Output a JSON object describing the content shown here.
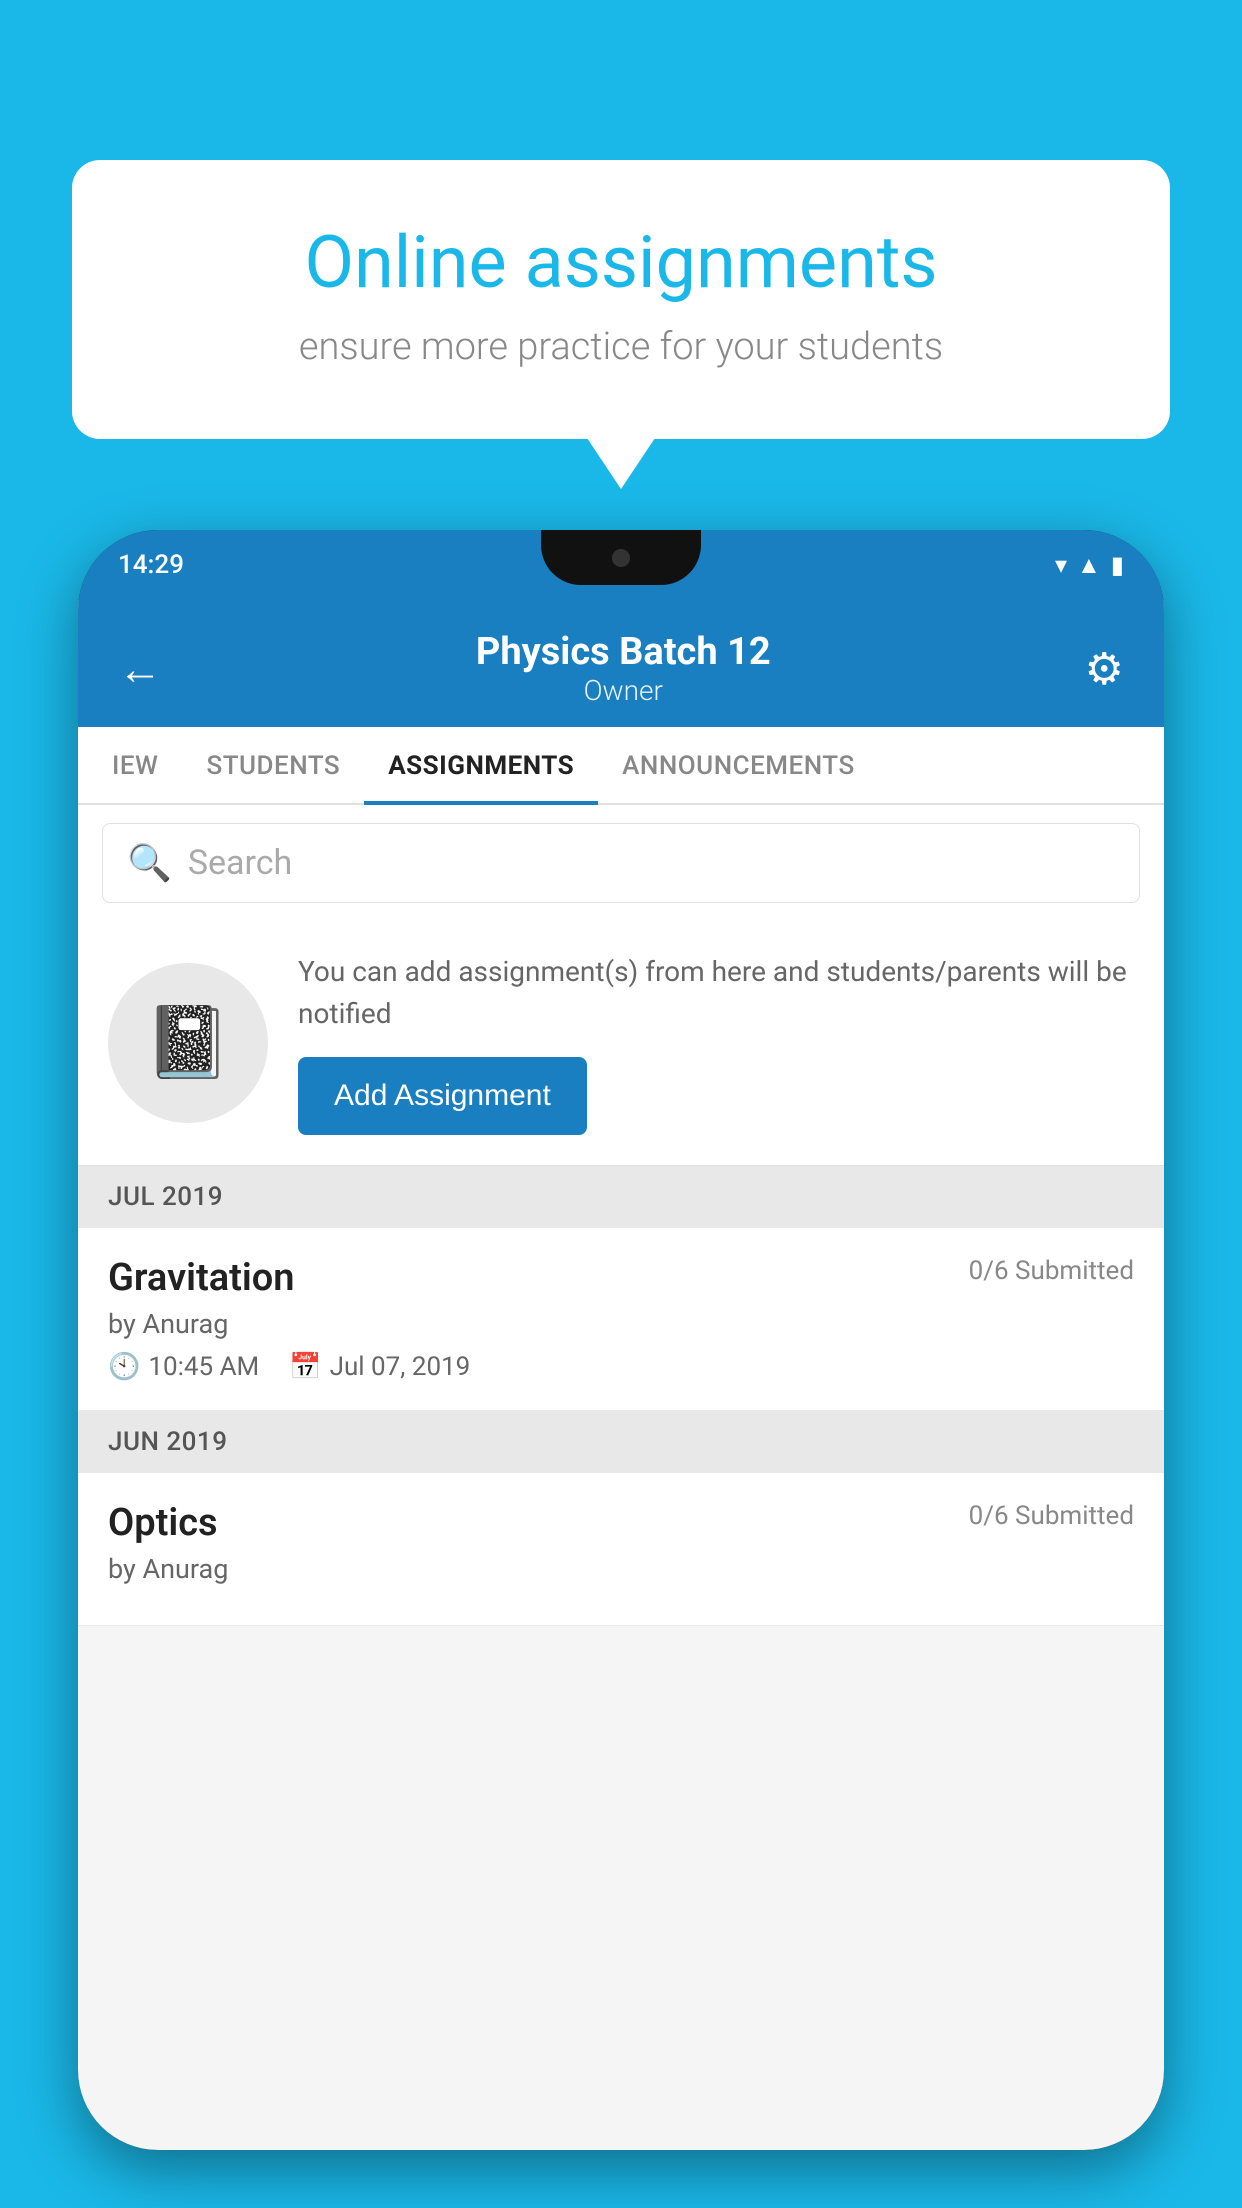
{
  "background_color": "#1ab8e8",
  "speech_bubble": {
    "title": "Online assignments",
    "subtitle": "ensure more practice for your students"
  },
  "phone": {
    "status_bar": {
      "time": "14:29",
      "icons": [
        "wifi",
        "signal",
        "battery"
      ]
    },
    "header": {
      "title": "Physics Batch 12",
      "subtitle": "Owner",
      "back_label": "←",
      "settings_label": "⚙"
    },
    "tabs": [
      {
        "label": "IEW",
        "active": false
      },
      {
        "label": "STUDENTS",
        "active": false
      },
      {
        "label": "ASSIGNMENTS",
        "active": true
      },
      {
        "label": "ANNOUNCEMENTS",
        "active": false
      }
    ],
    "search": {
      "placeholder": "Search"
    },
    "promo": {
      "description": "You can add assignment(s) from here and students/parents will be notified",
      "button_label": "Add Assignment"
    },
    "sections": [
      {
        "label": "JUL 2019",
        "assignments": [
          {
            "name": "Gravitation",
            "submitted": "0/6 Submitted",
            "by": "by Anurag",
            "time": "10:45 AM",
            "date": "Jul 07, 2019"
          }
        ]
      },
      {
        "label": "JUN 2019",
        "assignments": [
          {
            "name": "Optics",
            "submitted": "0/6 Submitted",
            "by": "by Anurag",
            "time": "",
            "date": ""
          }
        ]
      }
    ]
  }
}
